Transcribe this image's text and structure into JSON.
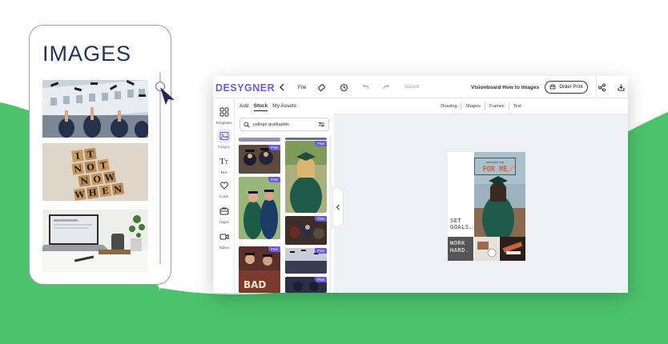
{
  "phone": {
    "title": "IMAGES",
    "thumbnails": [
      {
        "name": "graduation-caps-photo"
      },
      {
        "name": "scrabble-tiles-photo",
        "tiles": [
          "I",
          "T",
          "N",
          "O",
          "T",
          "N",
          "O",
          "W",
          "W",
          "H",
          "E",
          "N"
        ]
      },
      {
        "name": "laptop-desk-photo"
      }
    ]
  },
  "editor": {
    "brand": "DESYGNER",
    "file_label": "File",
    "saved_label": "Saved!",
    "doc_title": "Visionboard How to Images",
    "order_print_label": "Order Print",
    "rail": [
      {
        "label": "Templates",
        "icon": "templates-icon"
      },
      {
        "label": "Images",
        "icon": "images-icon",
        "active": true
      },
      {
        "label": "Text",
        "icon": "text-icon"
      },
      {
        "label": "Icons",
        "icon": "heart-icon"
      },
      {
        "label": "Logos",
        "icon": "logos-icon"
      },
      {
        "label": "Video",
        "icon": "video-icon"
      }
    ],
    "panel": {
      "tabs": [
        "Add",
        "Stock",
        "My Assets"
      ],
      "active_tab": "Stock",
      "search_value": "college graduation",
      "free_badge": "Free"
    },
    "canvas_tools": [
      "Drawing",
      "Shapes",
      "Frames",
      "Text"
    ],
    "artboard": {
      "set_goals_line1": "SET",
      "set_goals_line2": "GOALS.",
      "work_line1": "WORK",
      "work_line2": "HARD.",
      "forme_small": "DESIGNED FOR",
      "forme_big": "FOR ME"
    }
  },
  "colors": {
    "green": "#4cc26d",
    "brand_purple": "#6d5bd8",
    "phone_title": "#26315f"
  }
}
